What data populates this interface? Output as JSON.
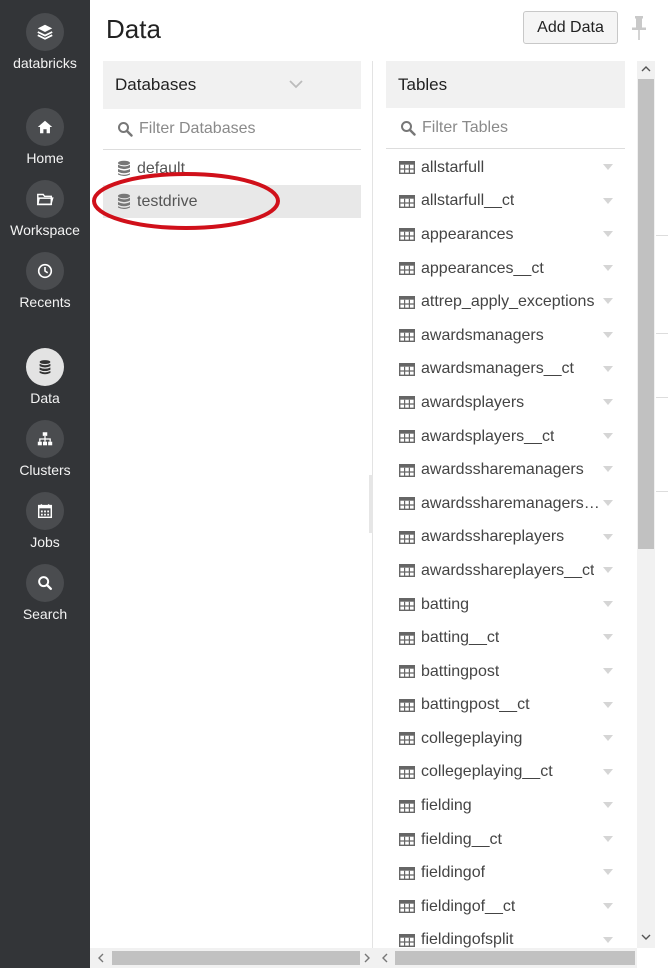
{
  "sidebar": {
    "brand": "databricks",
    "items": [
      {
        "label": "Home",
        "icon": "home-icon"
      },
      {
        "label": "Workspace",
        "icon": "folder-icon"
      },
      {
        "label": "Recents",
        "icon": "clock-icon"
      },
      {
        "label": "Data",
        "icon": "database-icon",
        "active": true
      },
      {
        "label": "Clusters",
        "icon": "clusters-icon"
      },
      {
        "label": "Jobs",
        "icon": "calendar-icon"
      },
      {
        "label": "Search",
        "icon": "search-icon"
      }
    ]
  },
  "header": {
    "title": "Data",
    "add_data_label": "Add Data"
  },
  "databases": {
    "header": "Databases",
    "filter_placeholder": "Filter Databases",
    "items": [
      "default",
      "testdrive"
    ],
    "selected": "testdrive"
  },
  "tables": {
    "header": "Tables",
    "filter_placeholder": "Filter Tables",
    "items": [
      "allstarfull",
      "allstarfull__ct",
      "appearances",
      "appearances__ct",
      "attrep_apply_exceptions",
      "awardsmanagers",
      "awardsmanagers__ct",
      "awardsplayers",
      "awardsplayers__ct",
      "awardssharemanagers",
      "awardssharemanagers__ct",
      "awardsshareplayers",
      "awardsshareplayers__ct",
      "batting",
      "batting__ct",
      "battingpost",
      "battingpost__ct",
      "collegeplaying",
      "collegeplaying__ct",
      "fielding",
      "fielding__ct",
      "fieldingof",
      "fieldingof__ct",
      "fieldingofsplit"
    ]
  },
  "colors": {
    "sidebar_bg": "#333538",
    "annotation": "#d0101a",
    "selected_row": "#e8e8e8"
  }
}
